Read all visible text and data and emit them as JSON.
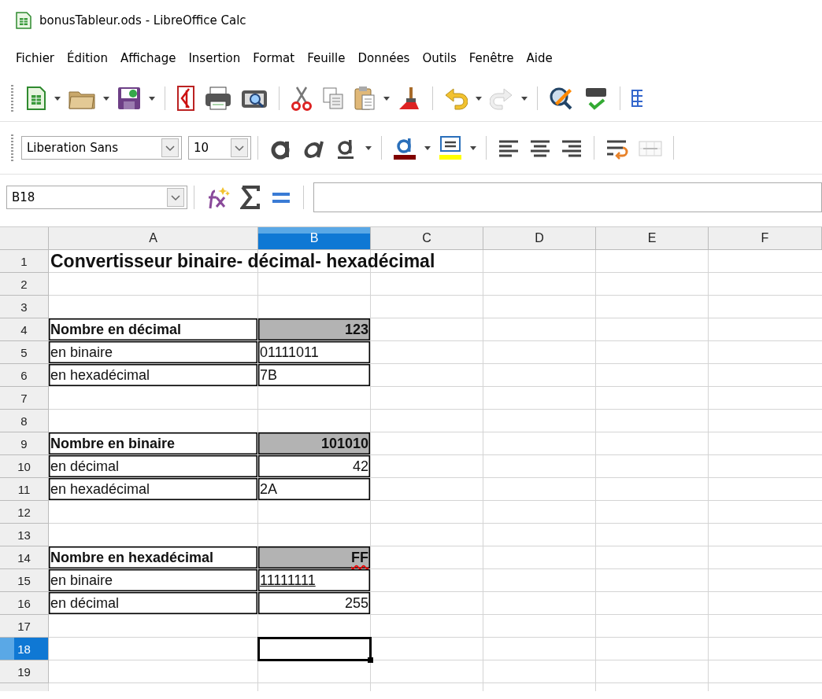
{
  "window": {
    "title": "bonusTableur.ods - LibreOffice Calc"
  },
  "menu": [
    {
      "label": "Fichier"
    },
    {
      "label": "Édition"
    },
    {
      "label": "Affichage"
    },
    {
      "label": "Insertion"
    },
    {
      "label": "Format"
    },
    {
      "label": "Feuille"
    },
    {
      "label": "Données"
    },
    {
      "label": "Outils"
    },
    {
      "label": "Fenêtre"
    },
    {
      "label": "Aide"
    }
  ],
  "format_bar": {
    "font_name": "Liberation Sans",
    "font_size": "10"
  },
  "formula_bar": {
    "name_box": "B18"
  },
  "sheet": {
    "columns": [
      {
        "label": "A",
        "selected": false
      },
      {
        "label": "B",
        "selected": true
      },
      {
        "label": "C",
        "selected": false
      },
      {
        "label": "D",
        "selected": false
      },
      {
        "label": "E",
        "selected": false
      },
      {
        "label": "F",
        "selected": false
      }
    ],
    "rows": [
      {
        "label": "1",
        "selected": false,
        "a": {
          "text": "Convertisseur binaire- décimal- hexadécimal",
          "bold": true,
          "large": true
        }
      },
      {
        "label": "2",
        "selected": false
      },
      {
        "label": "3",
        "selected": false
      },
      {
        "label": "4",
        "selected": false,
        "a": {
          "text": "Nombre en décimal",
          "bold": true,
          "bordered": true
        },
        "b": {
          "text": "123",
          "bold": true,
          "shaded": true,
          "bordered": true,
          "right_aligned": true
        }
      },
      {
        "label": "5",
        "selected": false,
        "a": {
          "text": "en binaire",
          "bordered": true
        },
        "b": {
          "text": "01111011",
          "bordered": true
        }
      },
      {
        "label": "6",
        "selected": false,
        "a": {
          "text": "en hexadécimal",
          "bordered": true
        },
        "b": {
          "text": "7B",
          "bordered": true
        }
      },
      {
        "label": "7",
        "selected": false
      },
      {
        "label": "8",
        "selected": false
      },
      {
        "label": "9",
        "selected": false,
        "a": {
          "text": "Nombre en binaire",
          "bold": true,
          "bordered": true
        },
        "b": {
          "text": "101010",
          "bold": true,
          "shaded": true,
          "bordered": true,
          "right_aligned": true
        }
      },
      {
        "label": "10",
        "selected": false,
        "a": {
          "text": "en décimal",
          "bordered": true
        },
        "b": {
          "text": "42",
          "bordered": true,
          "right_aligned": true
        }
      },
      {
        "label": "11",
        "selected": false,
        "a": {
          "text": "en hexadécimal",
          "bordered": true
        },
        "b": {
          "text": "2A",
          "bordered": true
        }
      },
      {
        "label": "12",
        "selected": false
      },
      {
        "label": "13",
        "selected": false
      },
      {
        "label": "14",
        "selected": false,
        "a": {
          "text": "Nombre en hexadécimal",
          "bold": true,
          "bordered": true
        },
        "b": {
          "text": "FF",
          "bold": true,
          "shaded": true,
          "bordered": true,
          "misspelled": true,
          "right_aligned": true
        }
      },
      {
        "label": "15",
        "selected": false,
        "a": {
          "text": "en binaire",
          "bordered": true
        },
        "b": {
          "text": "11111111",
          "bordered": true,
          "underlined": true
        }
      },
      {
        "label": "16",
        "selected": false,
        "a": {
          "text": "en décimal",
          "bordered": true
        },
        "b": {
          "text": "255",
          "bordered": true,
          "right_aligned": true
        }
      },
      {
        "label": "17",
        "selected": false
      },
      {
        "label": "18",
        "selected": true,
        "b": {
          "active": true
        }
      },
      {
        "label": "19",
        "selected": false
      }
    ]
  }
}
